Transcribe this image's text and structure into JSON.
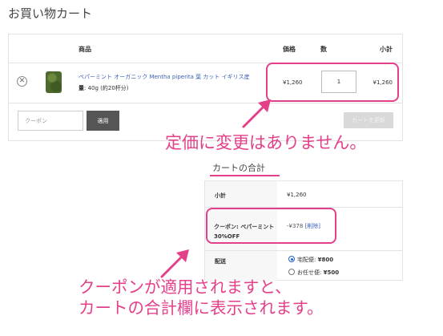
{
  "page_title": "お買い物カート",
  "cart": {
    "headers": {
      "product": "商品",
      "price": "価格",
      "quantity": "数",
      "subtotal": "小計"
    },
    "item": {
      "name": "ペパーミント オーガニック Mentha piperita 葉 カット イギリス産",
      "weight_label": "量",
      "weight_value": ": 40g (約20杯分)",
      "price": "¥1,260",
      "quantity": "1",
      "subtotal": "¥1,260",
      "remove_symbol": "✕"
    },
    "coupon_placeholder": "クーポン",
    "apply_label": "適用",
    "update_label": "カートを更新"
  },
  "annotations": {
    "price_note": "定価に変更はありません。",
    "coupon_note_line1": "クーポンが適用されますと、",
    "coupon_note_line2": "カートの合計欄に表示されます。"
  },
  "totals": {
    "title": "カートの合計",
    "subtotal_label": "小計",
    "subtotal_value": "¥1,260",
    "coupon_label": "クーポン: ペパーミント30%OFF",
    "coupon_value": "-¥378",
    "coupon_remove": "[削除]",
    "shipping_label": "配送",
    "shipping_options": [
      {
        "label": "宅配便: ",
        "price": "¥800",
        "selected": true
      },
      {
        "label": "お任せ便: ",
        "price": "¥500",
        "selected": false
      }
    ]
  },
  "colors": {
    "accent": "#e4408a",
    "link": "#3d63b8",
    "button_dark": "#555555"
  }
}
